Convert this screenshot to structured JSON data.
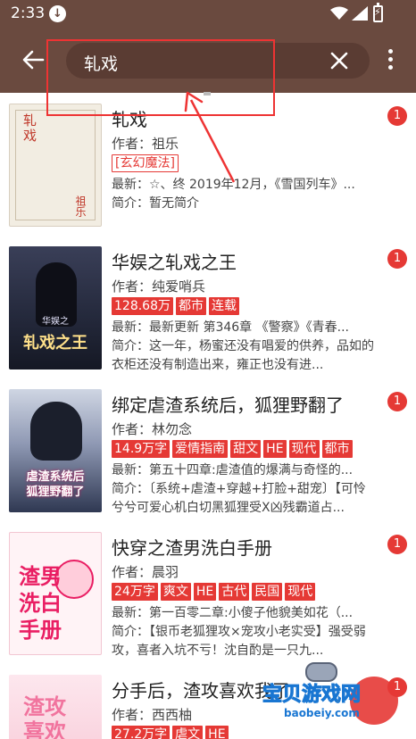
{
  "status_bar": {
    "time": "2:33",
    "download_icon": "download-icon",
    "wifi_icon": "wifi-icon",
    "signal_icon": "signal-icon",
    "battery_icon": "battery-charging-icon"
  },
  "toolbar": {
    "back_icon": "back-arrow-icon",
    "search_query": "轧戏",
    "clear_icon": "close-icon",
    "more_icon": "more-vertical-icon"
  },
  "results": [
    {
      "cover_text": [
        "轧戏",
        "祖乐"
      ],
      "title": "轧戏",
      "author": "作者：祖乐",
      "tags": [
        "[玄幻魔法]"
      ],
      "latest": "最新：☆、终 2019年12月，《雪国列车》...",
      "intro": "简介：暂无简介",
      "badge": "1"
    },
    {
      "cover_text": [
        "华娱之",
        "轧戏之王"
      ],
      "title": "华娱之轧戏之王",
      "author": "作者：纯爱哨兵",
      "tags": [
        "128.68万",
        "都市",
        "连载"
      ],
      "latest": "最新：最新更新 第346章 《警察》《青春...",
      "intro": "简介：这一年，杨蜜还没有唱爱的供养，品如的衣柜还没有制造出来，雍正也没有进...",
      "badge": "1"
    },
    {
      "cover_text": [
        "虐渣系统后",
        "狐狸野翻了"
      ],
      "title": "绑定虐渣系统后，狐狸野翻了",
      "author": "作者：林勿念",
      "tags": [
        "14.9万字",
        "爱情指南",
        "甜文",
        "HE",
        "现代",
        "都市"
      ],
      "latest": "最新：第五十四章:虐渣值的爆满与奇怪的...",
      "intro": "简介：〔系统+虐渣+穿越+打脸+甜宠〕【可怜兮兮可爱心机白切黑狐狸受X凶残霸道占...",
      "badge": "1"
    },
    {
      "cover_text": [
        "渣男洗白手册"
      ],
      "title": "快穿之渣男洗白手册",
      "author": "作者：晨羽",
      "tags": [
        "24万字",
        "爽文",
        "HE",
        "古代",
        "民国",
        "现代"
      ],
      "latest": "最新：第一百零二章:小傻子他貌美如花（...",
      "intro": "简介：【银币老狐狸攻×宠攻小老实受】强受弱攻，喜者入坑不亏！沈自酌是一只九...",
      "badge": "1"
    },
    {
      "cover_text": [
        "渣攻喜欢"
      ],
      "title": "分手后，渣攻喜欢我了",
      "author": "作者：西西柚",
      "tags": [
        "27.2万字",
        "虐文",
        "HE"
      ],
      "latest": "",
      "intro": "",
      "badge": "1"
    }
  ],
  "watermark": {
    "logo": "宝贝游戏网",
    "url": "baobeiy.com"
  },
  "colors": {
    "app_bar": "#6a4a3f",
    "search_bg": "#5a3c33",
    "tag_red": "#e53935",
    "annotation_red": "#e33333"
  }
}
